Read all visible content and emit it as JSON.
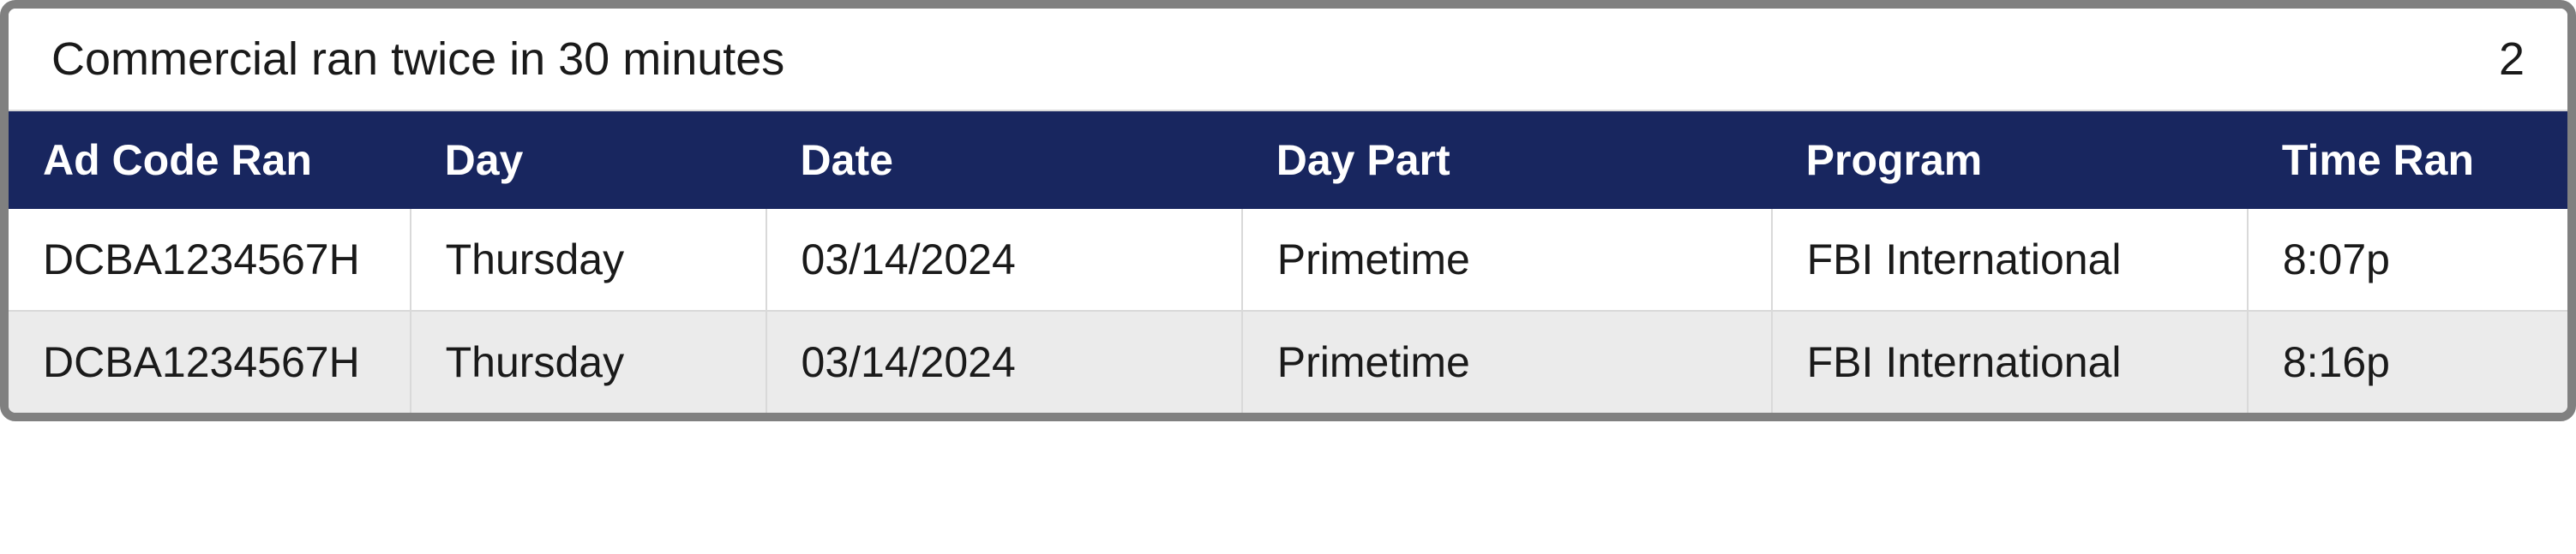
{
  "title": "Commercial ran twice in 30 minutes",
  "count": "2",
  "columns": {
    "ad_code": "Ad Code Ran",
    "day": "Day",
    "date": "Date",
    "day_part": "Day Part",
    "program": "Program",
    "time_ran": "Time Ran"
  },
  "rows": [
    {
      "ad_code": "DCBA1234567H",
      "day": "Thursday",
      "date": "03/14/2024",
      "day_part": "Primetime",
      "program": "FBI International",
      "time_ran": "8:07p"
    },
    {
      "ad_code": "DCBA1234567H",
      "day": "Thursday",
      "date": "03/14/2024",
      "day_part": "Primetime",
      "program": "FBI International",
      "time_ran": "8:16p"
    }
  ]
}
